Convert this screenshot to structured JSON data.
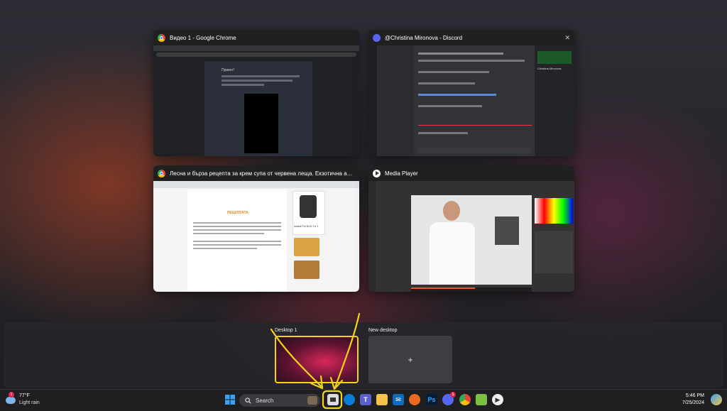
{
  "windows": [
    {
      "title": "Видео 1 - Google Chrome",
      "icon": "chrome-icon"
    },
    {
      "title": "@Christina Mironova - Discord",
      "icon": "discord-icon"
    },
    {
      "title": "Лесна и бърза рецепта за крем супа от червена леща. Екзотична ароматна супа от че...",
      "icon": "chrome-icon"
    },
    {
      "title": "Media Player",
      "icon": "media-player-icon"
    }
  ],
  "thumb_text": {
    "chrome_post": "Привет!",
    "recipe_heading": "РЕЦЕПТАТА",
    "recipe_banner": "Instant Pot DUO 7 в 1",
    "discord_name": "Christina Mironova"
  },
  "desktops": [
    {
      "label": "Desktop 1"
    },
    {
      "label": "New desktop",
      "plus": "+"
    }
  ],
  "taskbar": {
    "weather_temp": "77°F",
    "weather_desc": "Light rain",
    "weather_badge": "1",
    "search_label": "Search",
    "time": "5:46 PM",
    "date": "7/25/2024",
    "discord_badge": "1"
  },
  "colors": {
    "annotation": "#f2d21b",
    "accent": "#0078d4"
  }
}
